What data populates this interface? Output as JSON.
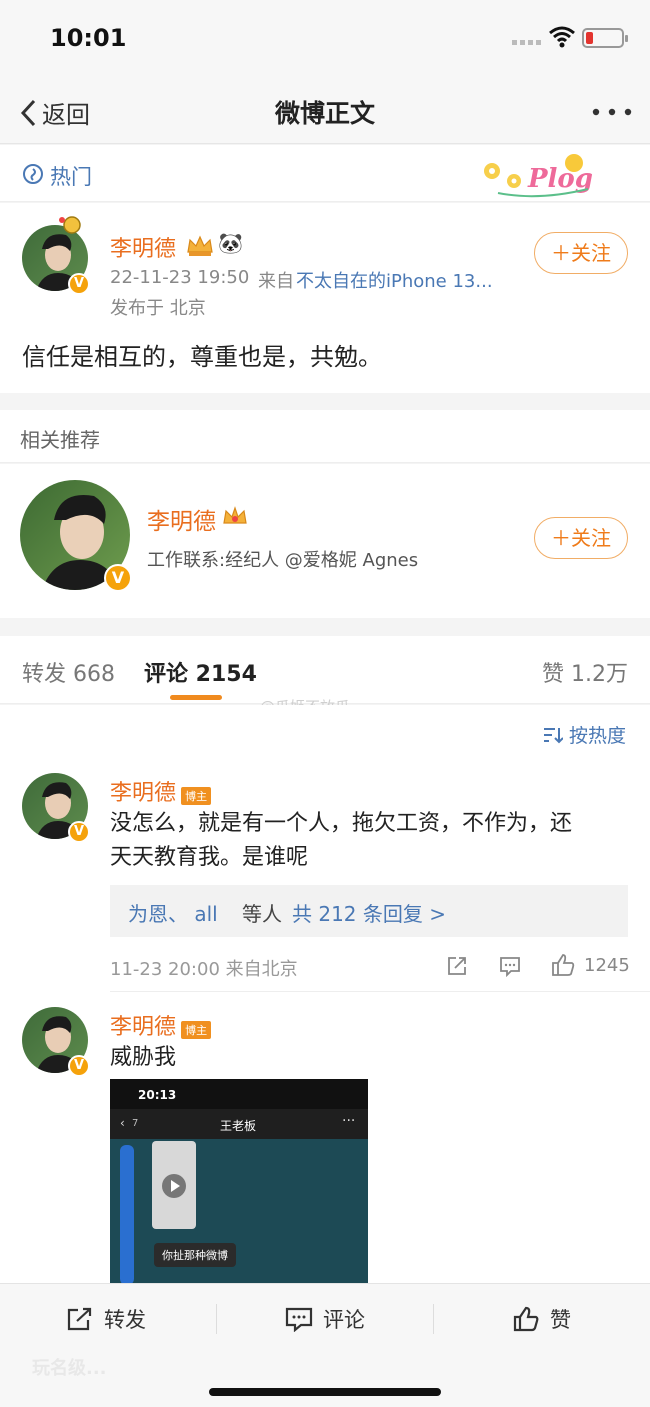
{
  "status": {
    "time": "10:01"
  },
  "nav": {
    "back_label": "返回",
    "title": "微博正文"
  },
  "hot": {
    "label": "热门",
    "sticker_text": "Plog"
  },
  "post": {
    "author": "李明德",
    "time": "22-11-23 19:50",
    "source_prefix": "来自",
    "source": "不太自在的iPhone 13...",
    "location": "发布于 北京",
    "text": "信任是相互的，尊重也是，共勉。",
    "follow_label": "＋关注",
    "author_emoji": "🐼"
  },
  "related": {
    "heading": "相关推荐",
    "name": "李明德",
    "desc": "工作联系:经纪人 @爱格妮 Agnes",
    "follow_label": "＋关注"
  },
  "tabs": {
    "repost": "转发 668",
    "comments": "评论 2154",
    "likes": "赞 1.2万",
    "watermark": "@瓜姬不放瓜"
  },
  "sort_label": "按热度",
  "comments": [
    {
      "author": "李明德",
      "badge": "博主",
      "text_line1": "没怎么，就是有一个人，拖欠工资，不作为，还",
      "text_line2": "天天教育我。是谁呢",
      "reply_names": "为恩、 all",
      "reply_suffix": "等人",
      "reply_count": "共 212 条回复 >",
      "time": "11-23 20:00 来自北京",
      "likes": "1245"
    },
    {
      "author": "李明德",
      "badge": "博主",
      "text": "威胁我",
      "image": {
        "time": "20:13",
        "chat_title": "王老板",
        "back_count": "7",
        "bubble": "你扯那种微博"
      }
    }
  ],
  "bottom": {
    "repost": "转发",
    "comment": "评论",
    "like": "赞"
  },
  "corner_watermark": "玩名级..."
}
